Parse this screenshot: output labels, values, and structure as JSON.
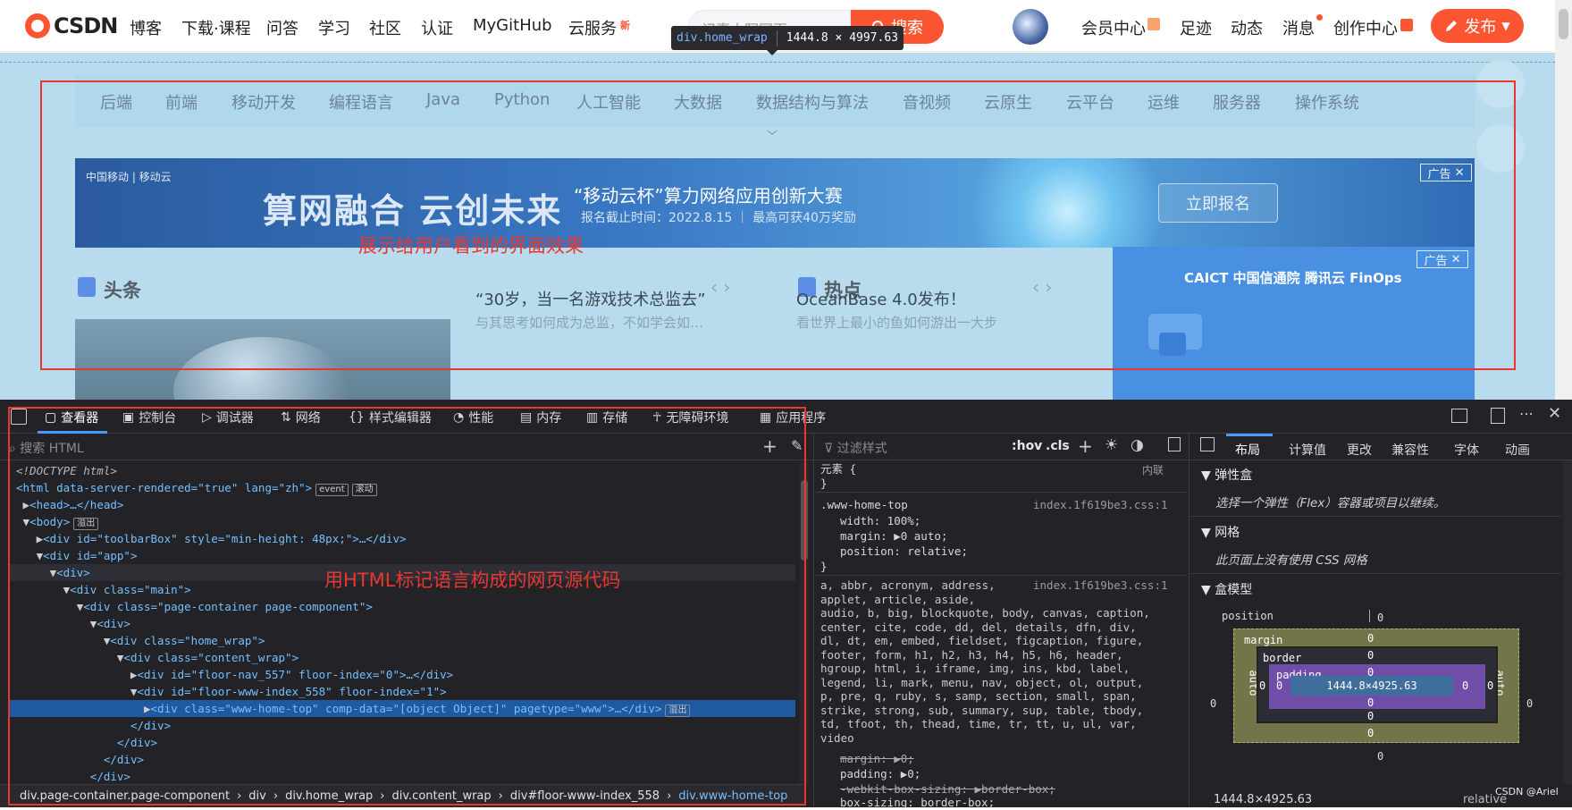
{
  "topnav": {
    "logo": "CSDN",
    "items": [
      "博客",
      "下载·课程",
      "问答",
      "学习",
      "社区",
      "认证",
      "MyGitHub",
      "云服务"
    ],
    "new_tag": "新",
    "search_placeholder": "记事本写网页",
    "search_button": "搜索",
    "right_items": [
      "会员中心",
      "足迹",
      "动态",
      "消息",
      "创作中心"
    ],
    "publish_button": "发布"
  },
  "tooltip": {
    "selector": "div.home_wrap",
    "size": "1444.8 × 4997.63"
  },
  "page": {
    "categories": [
      "后端",
      "前端",
      "移动开发",
      "编程语言",
      "Java",
      "Python",
      "人工智能",
      "大数据",
      "数据结构与算法",
      "音视频",
      "云原生",
      "云平台",
      "运维",
      "服务器",
      "操作系统"
    ],
    "banner": {
      "brand": "中国移动 | 移动云",
      "slogan": "算网融合 云创未来",
      "title": "“移动云杯”算力网络应用创新大赛",
      "subtitle": "报名截止时间：2022.8.15 ｜ 最高可获40万奖励",
      "button": "立即报名",
      "ad_label": "广告"
    },
    "section1": {
      "title": "头条",
      "headline": "“30岁，当一名游戏技术总监去”",
      "sub": "与其思考如何成为总监，不如学会如…"
    },
    "section2": {
      "title": "热点",
      "headline": "OceanBase 4.0发布！",
      "sub": "看世界上最小的鱼如何游出一大步"
    },
    "ad2": {
      "label": "广告",
      "logos": "CAICT 中国信通院  腾讯云  FinOps"
    },
    "annotation_top": "展示给用户看到的界面效果",
    "annotation_bottom": "用HTML标记语言构成的网页源代码"
  },
  "devtools": {
    "tabs": [
      "查看器",
      "控制台",
      "调试器",
      "网络",
      "样式编辑器",
      "性能",
      "内存",
      "存储",
      "无障碍环境",
      "应用程序"
    ],
    "search_placeholder": "搜索 HTML",
    "filter_placeholder": "过滤样式",
    "hov": ":hov",
    "cls": ".cls",
    "html_lines": [
      "<!DOCTYPE html>",
      "<html data-server-rendered=\"true\" lang=\"zh\">",
      "<head>…</head>",
      "<body>",
      "<div id=\"toolbarBox\" style=\"min-height: 48px;\">…</div>",
      "<div id=\"app\">",
      "<div>",
      "<div class=\"main\">",
      "<div class=\"page-container page-component\">",
      "<div>",
      "<div class=\"home_wrap\">",
      "<div class=\"content_wrap\">",
      "<div id=\"floor-nav_557\" floor-index=\"0\">…</div>",
      "<div id=\"floor-www-index_558\" floor-index=\"1\">",
      "<div class=\"www-home-top\" comp-data=\"[object Object]\" pagetype=\"www\">…</div>",
      "</div>",
      "</div>",
      "</div>",
      "</div>"
    ],
    "badges": {
      "event": "event",
      "scroll": "滚动",
      "overflow": "溢出"
    },
    "breadcrumbs": [
      "div.page-container.page-component",
      "div",
      "div.home_wrap",
      "div.content_wrap",
      "div#floor-www-index_558",
      "div.www-home-top"
    ],
    "rules": {
      "element_label": "元素 {",
      "inline": "内联",
      "rule1_selector": ".www-home-top",
      "rule1_src": "index.1f619be3.css:1",
      "rule1_props": [
        "width: 100%;",
        "margin: ▶0 auto;",
        "position: relative;"
      ],
      "rule2_src": "index.1f619be3.css:1",
      "rule2_selector": "a, abbr, acronym, address,\napplet, article, aside,\naudio, b, big, blockquote, body, canvas, caption,\ncenter, cite, code, dd, del, details, dfn, div,\ndl, dt, em, embed, fieldset, figcaption, figure,\nfooter, form, h1, h2, h3, h4, h5, h6, header,\nhgroup, html, i, iframe, img, ins, kbd, label,\nlegend, li, mark, menu, nav, object, ol, output,\np, pre, q, ruby, s, samp, section, small, span,\nstrike, strong, sub, summary, sup, table, tbody,\ntd, tfoot, th, thead, time, tr, tt, u, ul, var,\nvideo",
      "rule2_props": [
        "margin: ▶0;",
        "padding: ▶0;",
        "-webkit-box-sizing: ▶border-box;",
        "box-sizing: border-box;"
      ]
    },
    "layout_tabs": [
      "布局",
      "计算值",
      "更改",
      "兼容性",
      "字体",
      "动画"
    ],
    "flex_title": "弹性盒",
    "flex_info": "选择一个弹性（Flex）容器或项目以继续。",
    "grid_title": "网格",
    "grid_info": "此页面上没有使用 CSS 网格",
    "boxmodel_title": "盒模型",
    "boxmodel": {
      "position": "position",
      "margin": "margin",
      "border": "border",
      "padding": "padding",
      "content": "1444.8×4925.63",
      "auto": "auto",
      "zero": "0"
    },
    "footer_size": "1444.8×4925.63",
    "footer_pos": "relative",
    "watermark": "CSDN @Ariel"
  }
}
